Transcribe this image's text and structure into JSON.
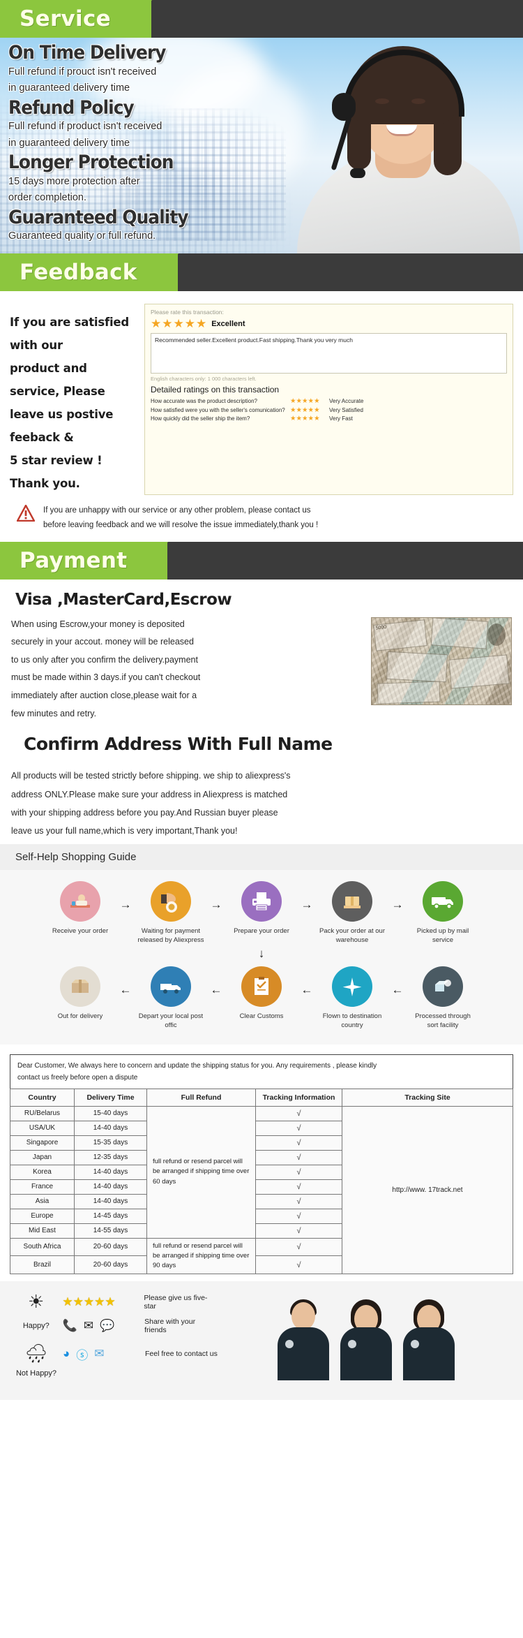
{
  "service": {
    "banner": "Service",
    "blocks": [
      {
        "heading": "On Time Delivery",
        "lines": [
          "Full refund if prouct isn't received",
          "in guaranteed delivery time"
        ]
      },
      {
        "heading": "Refund Policy",
        "lines": [
          "Full refund if product isn't received",
          "in guaranteed delivery time"
        ]
      },
      {
        "heading": "Longer Protection",
        "lines": [
          "15 days more protection after",
          "order completion."
        ]
      },
      {
        "heading": "Guaranteed Quality",
        "lines": [
          "Guaranteed quality or full refund."
        ]
      }
    ]
  },
  "feedback": {
    "banner": "Feedback",
    "left_lines": [
      "If you are satisfied with our",
      "product and service, Please",
      "leave us postive feeback &",
      "5 star review ! Thank you."
    ],
    "card": {
      "rate_hint": "Please rate this transaction:",
      "stars": "★★★★★",
      "rating_label": "Excellent",
      "review_text": "Recommended seller.Excellent product.Fast shipping.Thank you very much",
      "chars_note": "English characters only: 1 000 characters left.",
      "detail_title": "Detailed ratings on this transaction",
      "ratings": [
        {
          "question": "How accurate was the product description?",
          "stars": "★★★★★",
          "value": "Very Accurate"
        },
        {
          "question": "How satisfied were you with the seller's comunication?",
          "stars": "★★★★★",
          "value": "Very Satisfied"
        },
        {
          "question": "How quickly did the seller ship the item?",
          "stars": "★★★★★",
          "value": "Very Fast"
        }
      ]
    },
    "warning": [
      "If you are unhappy with our service or any other problem, please contact us",
      "before leaving feedback and we will resolve the issue immediately,thank you !"
    ]
  },
  "payment": {
    "banner": "Payment",
    "title": "Visa ,MasterCard,Escrow",
    "paragraph": [
      "When using Escrow,your money is deposited",
      "securely in your accout. money will be released",
      "to us only after you confirm the delivery.payment",
      "must be made within 3 days.if you can't checkout",
      "immediately after auction close,please wait for a",
      "few minutes and retry."
    ],
    "money_denomination": "5000",
    "address_title": "Confirm Address With Full Name",
    "address_paragraph": [
      "All products will be tested strictly before shipping. we ship to aliexpress's",
      "address ONLY.Please make sure your address in Aliexpress is matched",
      "with your shipping address before you pay.And Russian buyer please",
      "leave us your full name,which is very important,Thank you!"
    ]
  },
  "guide": {
    "title": "Self-Help Shopping Guide",
    "row1": [
      {
        "icon": "person-computer-icon",
        "label": "Receive your order",
        "color": "#e8a2ac"
      },
      {
        "icon": "money-hand-icon",
        "label": "Waiting for payment released by Aliexpress",
        "color": "#e9a12a"
      },
      {
        "icon": "printer-icon",
        "label": "Prepare your order",
        "color": "#9a6fc0"
      },
      {
        "icon": "package-hand-icon",
        "label": "Pack your order at our warehouse",
        "color": "#5e5e5e"
      },
      {
        "icon": "truck-icon",
        "label": "Picked up by mail service",
        "color": "#5aa832"
      }
    ],
    "row2": [
      {
        "icon": "parcel-box-icon",
        "label": "Out for delivery",
        "color": "#e3ddd2"
      },
      {
        "icon": "van-icon",
        "label": "Depart your local post offic",
        "color": "#2f7fb5"
      },
      {
        "icon": "clipboard-customs-icon",
        "label": "Clear  Customs",
        "color": "#d78b26"
      },
      {
        "icon": "airplane-icon",
        "label": "Flown to destination country",
        "color": "#1fa5c4"
      },
      {
        "icon": "sorting-icon",
        "label": "Processed through sort facility",
        "color": "#4a5a63"
      }
    ],
    "arrow_right": "→",
    "arrow_left": "←",
    "arrow_down": "↓"
  },
  "shipping": {
    "note": [
      "Dear Customer, We always here to concern and update the shipping status for you.  Any requirements , please kindly",
      "contact us freely before open a dispute"
    ],
    "columns": [
      "Country",
      "Delivery Time",
      "Full Refund",
      "Tracking Information",
      "Tracking Site"
    ],
    "rows": [
      {
        "country": "RU/Belarus",
        "time": "15-40 days",
        "tracking": "√"
      },
      {
        "country": "USA/UK",
        "time": "14-40 days",
        "tracking": "√"
      },
      {
        "country": "Singapore",
        "time": "15-35 days",
        "tracking": "√"
      },
      {
        "country": "Japan",
        "time": "12-35 days",
        "tracking": "√"
      },
      {
        "country": "Korea",
        "time": "14-40 days",
        "tracking": "√"
      },
      {
        "country": "France",
        "time": "14-40 days",
        "tracking": "√"
      },
      {
        "country": "Asia",
        "time": "14-40 days",
        "tracking": "√"
      },
      {
        "country": "Europe",
        "time": "14-45 days",
        "tracking": "√"
      },
      {
        "country": "Mid East",
        "time": "14-55 days",
        "tracking": "√"
      },
      {
        "country": "South Africa",
        "time": "20-60 days",
        "tracking": "√"
      },
      {
        "country": "Brazil",
        "time": "20-60 days",
        "tracking": "√"
      }
    ],
    "refund_60": "full refund or resend parcel will be arranged if shipping time over 60 days",
    "refund_90": "full refund or resend parcel will be arranged if shipping time over 90 days",
    "tracking_site": "http://www. 17track.net"
  },
  "footer": {
    "happy_label": "Happy?",
    "not_happy_label": "Not Happy?",
    "stars": "★★★★★",
    "line1": "Please give us five-star",
    "line2": "Share with your friends",
    "line3": "Feel free to contact us",
    "icons_happy": [
      "phone-ring-icon",
      "envelope-icon",
      "chat-bubble-icon"
    ],
    "icons_nothappy": [
      "trademanager-icon",
      "skype-icon",
      "mail-icon"
    ]
  },
  "colors": {
    "accent_green": "#8cc63e",
    "banner_dark": "#3b3b3b",
    "star_orange": "#f5a623",
    "star_yellow": "#f2c200"
  }
}
